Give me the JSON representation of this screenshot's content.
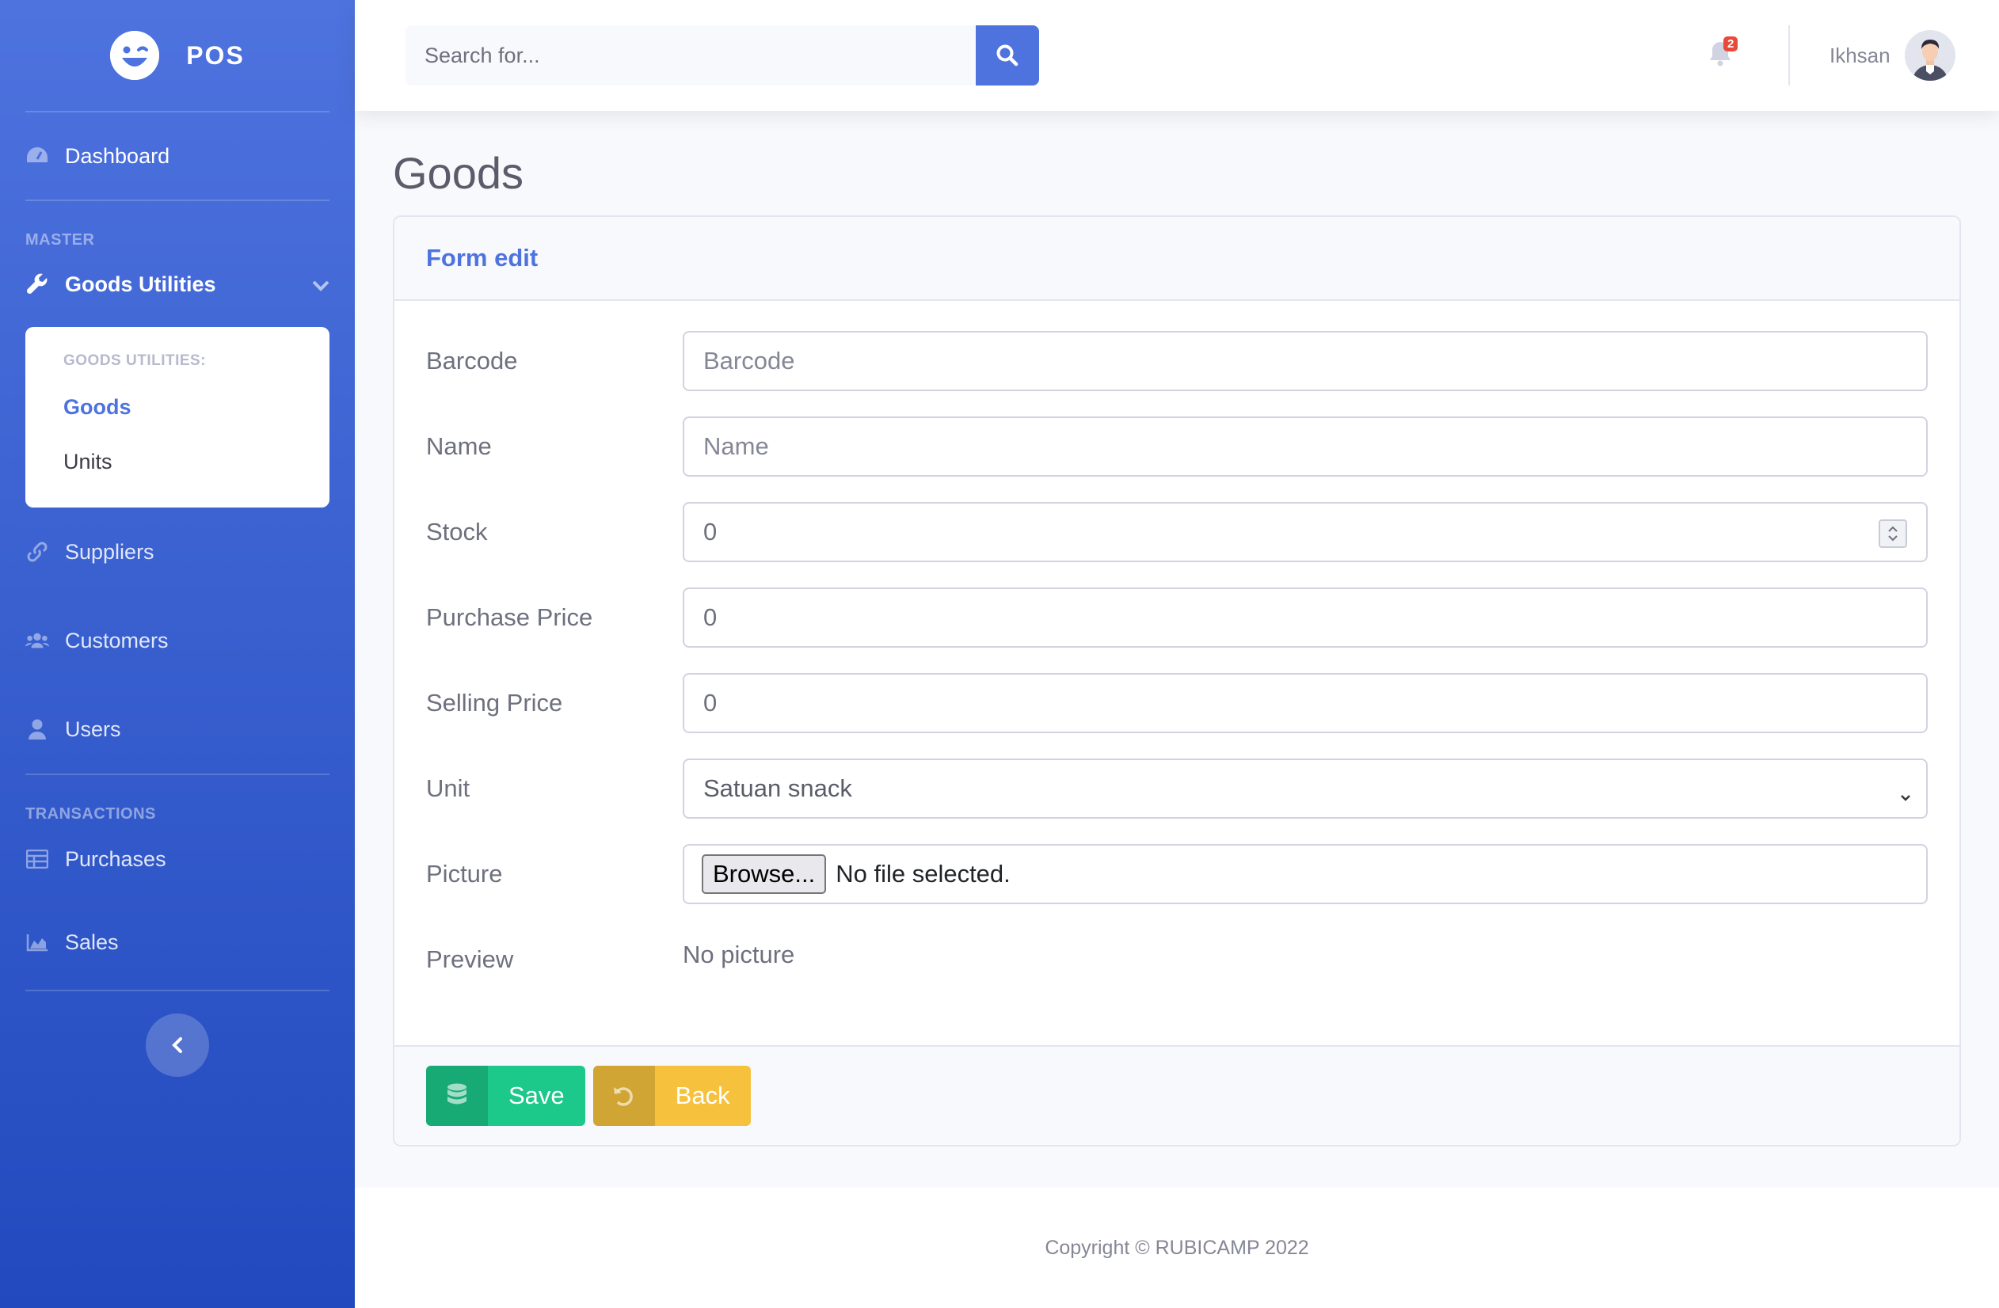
{
  "brand": {
    "name": "POS"
  },
  "sidebar": {
    "dashboard": "Dashboard",
    "section_master": "MASTER",
    "goods_utilities": "Goods Utilities",
    "submenu_heading": "GOODS UTILITIES:",
    "submenu_items": [
      "Goods",
      "Units"
    ],
    "suppliers": "Suppliers",
    "customers": "Customers",
    "users": "Users",
    "section_transactions": "TRANSACTIONS",
    "purchases": "Purchases",
    "sales": "Sales"
  },
  "topbar": {
    "search_placeholder": "Search for...",
    "notification_count": "2",
    "user_name": "Ikhsan"
  },
  "page": {
    "title": "Goods"
  },
  "form": {
    "header": "Form edit",
    "barcode_label": "Barcode",
    "barcode_placeholder": "Barcode",
    "name_label": "Name",
    "name_placeholder": "Name",
    "stock_label": "Stock",
    "stock_value": "0",
    "purchase_label": "Purchase Price",
    "purchase_value": "0",
    "selling_label": "Selling Price",
    "selling_value": "0",
    "unit_label": "Unit",
    "unit_value": "Satuan snack",
    "picture_label": "Picture",
    "browse_label": "Browse...",
    "file_status": "No file selected.",
    "preview_label": "Preview",
    "preview_value": "No picture",
    "save_label": "Save",
    "back_label": "Back"
  },
  "footer": {
    "copyright": "Copyright © RUBICAMP 2022"
  },
  "colors": {
    "primary": "#4e73df",
    "success": "#1cc88a",
    "warning": "#f6c23e",
    "danger": "#e74a3b"
  }
}
